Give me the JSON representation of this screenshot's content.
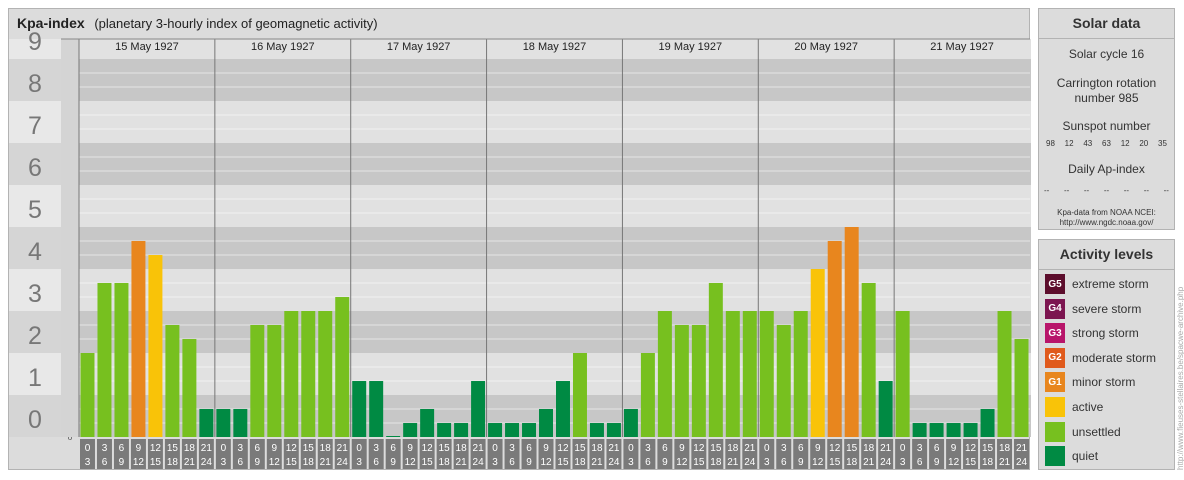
{
  "title": {
    "name": "Kpa-index",
    "subtitle": "(planetary 3-hourly index of geomagnetic activity)"
  },
  "chart_data": {
    "type": "bar",
    "days": [
      "15 May 1927",
      "16 May 1927",
      "17 May 1927",
      "18 May 1927",
      "19 May 1927",
      "20 May 1927",
      "21 May 1927"
    ],
    "interval_labels": [
      [
        "0",
        "3"
      ],
      [
        "3",
        "6"
      ],
      [
        "6",
        "9"
      ],
      [
        "9",
        "12"
      ],
      [
        "12",
        "15"
      ],
      [
        "15",
        "18"
      ],
      [
        "18",
        "21"
      ],
      [
        "21",
        "24"
      ]
    ],
    "values": [
      [
        2.0,
        3.667,
        3.667,
        4.667,
        4.333,
        2.667,
        2.333,
        0.667
      ],
      [
        0.667,
        0.667,
        2.667,
        2.667,
        3.0,
        3.0,
        3.0,
        3.333
      ],
      [
        1.333,
        1.333,
        0.0,
        0.333,
        0.667,
        0.333,
        0.333,
        1.333
      ],
      [
        0.333,
        0.333,
        0.333,
        0.667,
        1.333,
        2.0,
        0.333,
        0.333
      ],
      [
        0.667,
        2.0,
        3.0,
        2.667,
        2.667,
        3.667,
        3.0,
        3.0
      ],
      [
        3.0,
        2.667,
        3.0,
        4.0,
        4.667,
        5.0,
        3.667,
        1.333
      ],
      [
        3.0,
        0.333,
        0.333,
        0.333,
        0.333,
        0.667,
        3.0,
        2.333
      ]
    ],
    "ylim": [
      0,
      9
    ],
    "y_ticks": [
      "0",
      "1",
      "2",
      "3",
      "4",
      "5",
      "6",
      "7",
      "8",
      "9"
    ],
    "sub_ticks": [
      "+",
      "o",
      "-"
    ],
    "colors": {
      "quiet": "#008a43",
      "unsettled": "#77c01f",
      "active": "#f9c308",
      "minor_storm": "#e8861e",
      "moderate_storm": "#e05a1c"
    }
  },
  "solar": {
    "head": "Solar data",
    "cycle": "Solar cycle 16",
    "carrington_1": "Carrington rotation",
    "carrington_2": "number 985",
    "sunspot_label": "Sunspot number",
    "sunspots": [
      "98",
      "12",
      "43",
      "63",
      "12",
      "20",
      "35"
    ],
    "ap_label": "Daily Ap-index",
    "ap_values": [
      "--",
      "--",
      "--",
      "--",
      "--",
      "--",
      "--"
    ],
    "source_1": "Kpa-data from NOAA NCEI:",
    "source_2": "http://www.ngdc.noaa.gov/"
  },
  "activity": {
    "head": "Activity levels",
    "levels": [
      {
        "badge": "G5",
        "label": "extreme storm",
        "color": "#5c0d2c"
      },
      {
        "badge": "G4",
        "label": "severe storm",
        "color": "#7c1550"
      },
      {
        "badge": "G3",
        "label": "strong storm",
        "color": "#b8156a"
      },
      {
        "badge": "G2",
        "label": "moderate storm",
        "color": "#e05a1c"
      },
      {
        "badge": "G1",
        "label": "minor storm",
        "color": "#e8861e"
      },
      {
        "badge": "",
        "label": "active",
        "color": "#f9c308"
      },
      {
        "badge": "",
        "label": "unsettled",
        "color": "#77c01f"
      },
      {
        "badge": "",
        "label": "quiet",
        "color": "#008a43"
      }
    ]
  },
  "watermark": "http://www.fieuses-stellaires.be/spacwe-archive.php"
}
